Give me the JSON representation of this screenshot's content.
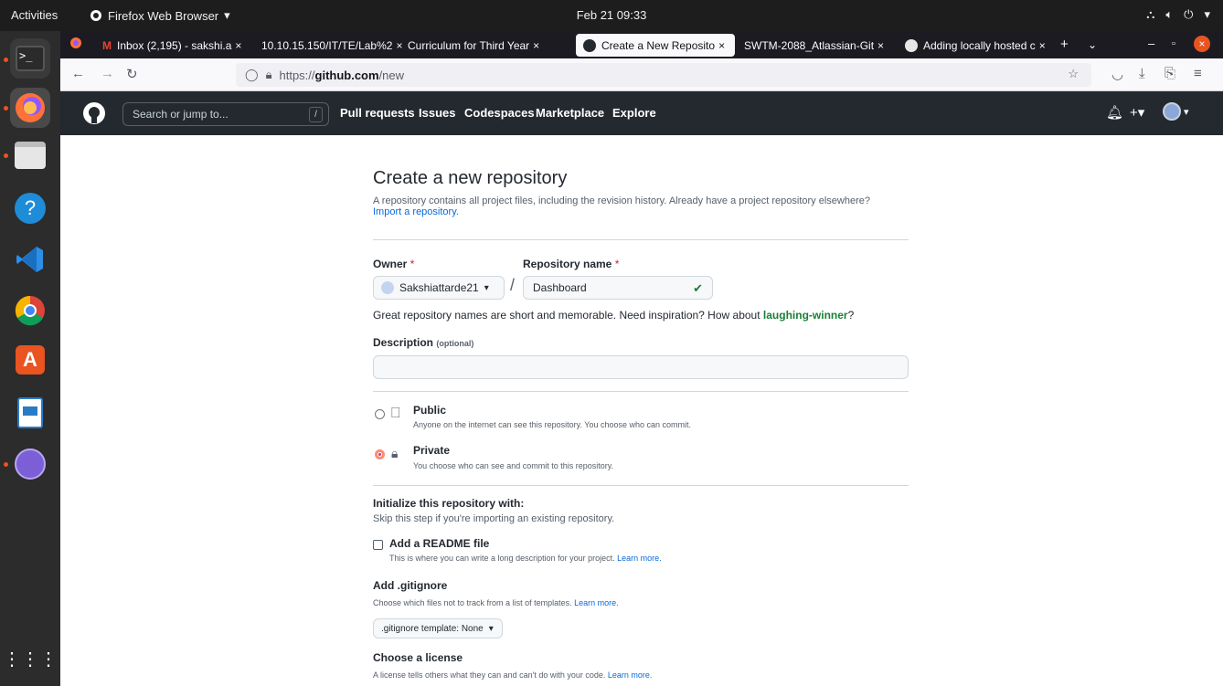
{
  "topbar": {
    "activities": "Activities",
    "app_name": "Firefox Web Browser",
    "clock": "Feb 21  09:33"
  },
  "tabs": [
    {
      "label": "Inbox (2,195) - sakshi.a",
      "icon": "gmail-icon"
    },
    {
      "label": "10.10.15.150/IT/TE/Lab%2",
      "icon": "none"
    },
    {
      "label": "Curriculum for Third Year",
      "icon": "none"
    },
    {
      "label": "Create a New Reposito",
      "icon": "github-icon",
      "active": true
    },
    {
      "label": "SWTM-2088_Atlassian-Git",
      "icon": "none"
    },
    {
      "label": "Adding locally hosted c",
      "icon": "github-icon"
    }
  ],
  "url": {
    "scheme": "https://",
    "host": "github.com",
    "path": "/new"
  },
  "gh_header": {
    "search_placeholder": "Search or jump to...",
    "search_shortcut": "/",
    "nav": [
      "Pull requests",
      "Issues",
      "Codespaces",
      "Marketplace",
      "Explore"
    ]
  },
  "page": {
    "title": "Create a new repository",
    "subtitle": "A repository contains all project files, including the revision history. Already have a project repository elsewhere?",
    "import_link": "Import a repository.",
    "owner_label": "Owner",
    "repo_label": "Repository name",
    "required_mark": "*",
    "owner_value": "Sakshiattarde21",
    "slash": "/",
    "repo_value": "Dashboard",
    "inspiration_prefix": "Great repository names are short and memorable. Need inspiration? How about",
    "inspiration_name": "laughing-winner",
    "inspiration_suffix": "?",
    "description_label": "Description",
    "description_optional": "(optional)",
    "description_value": "",
    "visibility": {
      "public_title": "Public",
      "public_desc": "Anyone on the internet can see this repository. You choose who can commit.",
      "private_title": "Private",
      "private_desc": "You choose who can see and commit to this repository.",
      "selected": "private"
    },
    "init_title": "Initialize this repository with:",
    "init_desc": "Skip this step if you're importing an existing repository.",
    "readme_title": "Add a README file",
    "readme_desc": "This is where you can write a long description for your project.",
    "learn_more": "Learn more.",
    "gitignore_title": "Add .gitignore",
    "gitignore_desc": "Choose which files not to track from a list of templates.",
    "gitignore_button": ".gitignore template: None",
    "license_title": "Choose a license",
    "license_desc": "A license tells others what they can and can't do with your code."
  },
  "colors": {
    "gh_header_bg": "#24292f",
    "accent_green": "#1a7f37",
    "link_blue": "#0969da",
    "required_red": "#cf222e"
  }
}
